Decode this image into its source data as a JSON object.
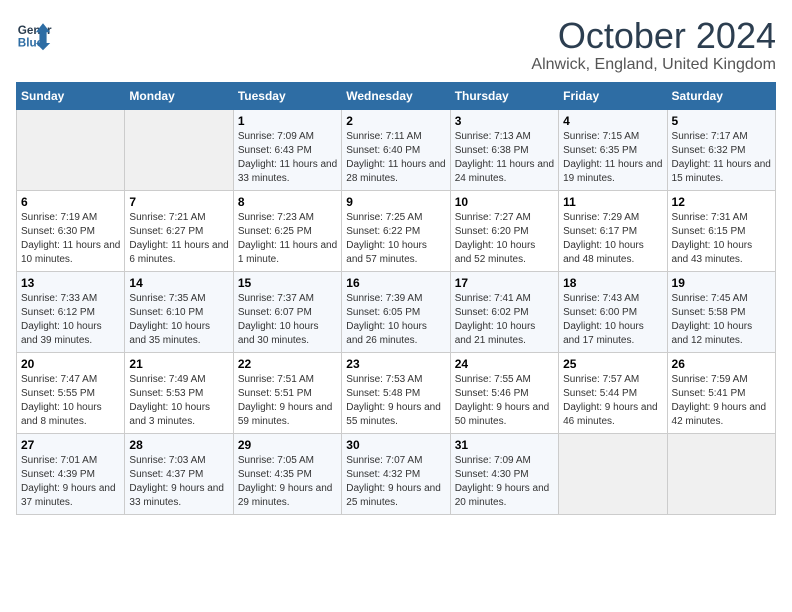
{
  "header": {
    "logo_line1": "General",
    "logo_line2": "Blue",
    "month": "October 2024",
    "location": "Alnwick, England, United Kingdom"
  },
  "days_of_week": [
    "Sunday",
    "Monday",
    "Tuesday",
    "Wednesday",
    "Thursday",
    "Friday",
    "Saturday"
  ],
  "weeks": [
    [
      {
        "day": "",
        "sunrise": "",
        "sunset": "",
        "daylight": ""
      },
      {
        "day": "",
        "sunrise": "",
        "sunset": "",
        "daylight": ""
      },
      {
        "day": "1",
        "sunrise": "Sunrise: 7:09 AM",
        "sunset": "Sunset: 6:43 PM",
        "daylight": "Daylight: 11 hours and 33 minutes."
      },
      {
        "day": "2",
        "sunrise": "Sunrise: 7:11 AM",
        "sunset": "Sunset: 6:40 PM",
        "daylight": "Daylight: 11 hours and 28 minutes."
      },
      {
        "day": "3",
        "sunrise": "Sunrise: 7:13 AM",
        "sunset": "Sunset: 6:38 PM",
        "daylight": "Daylight: 11 hours and 24 minutes."
      },
      {
        "day": "4",
        "sunrise": "Sunrise: 7:15 AM",
        "sunset": "Sunset: 6:35 PM",
        "daylight": "Daylight: 11 hours and 19 minutes."
      },
      {
        "day": "5",
        "sunrise": "Sunrise: 7:17 AM",
        "sunset": "Sunset: 6:32 PM",
        "daylight": "Daylight: 11 hours and 15 minutes."
      }
    ],
    [
      {
        "day": "6",
        "sunrise": "Sunrise: 7:19 AM",
        "sunset": "Sunset: 6:30 PM",
        "daylight": "Daylight: 11 hours and 10 minutes."
      },
      {
        "day": "7",
        "sunrise": "Sunrise: 7:21 AM",
        "sunset": "Sunset: 6:27 PM",
        "daylight": "Daylight: 11 hours and 6 minutes."
      },
      {
        "day": "8",
        "sunrise": "Sunrise: 7:23 AM",
        "sunset": "Sunset: 6:25 PM",
        "daylight": "Daylight: 11 hours and 1 minute."
      },
      {
        "day": "9",
        "sunrise": "Sunrise: 7:25 AM",
        "sunset": "Sunset: 6:22 PM",
        "daylight": "Daylight: 10 hours and 57 minutes."
      },
      {
        "day": "10",
        "sunrise": "Sunrise: 7:27 AM",
        "sunset": "Sunset: 6:20 PM",
        "daylight": "Daylight: 10 hours and 52 minutes."
      },
      {
        "day": "11",
        "sunrise": "Sunrise: 7:29 AM",
        "sunset": "Sunset: 6:17 PM",
        "daylight": "Daylight: 10 hours and 48 minutes."
      },
      {
        "day": "12",
        "sunrise": "Sunrise: 7:31 AM",
        "sunset": "Sunset: 6:15 PM",
        "daylight": "Daylight: 10 hours and 43 minutes."
      }
    ],
    [
      {
        "day": "13",
        "sunrise": "Sunrise: 7:33 AM",
        "sunset": "Sunset: 6:12 PM",
        "daylight": "Daylight: 10 hours and 39 minutes."
      },
      {
        "day": "14",
        "sunrise": "Sunrise: 7:35 AM",
        "sunset": "Sunset: 6:10 PM",
        "daylight": "Daylight: 10 hours and 35 minutes."
      },
      {
        "day": "15",
        "sunrise": "Sunrise: 7:37 AM",
        "sunset": "Sunset: 6:07 PM",
        "daylight": "Daylight: 10 hours and 30 minutes."
      },
      {
        "day": "16",
        "sunrise": "Sunrise: 7:39 AM",
        "sunset": "Sunset: 6:05 PM",
        "daylight": "Daylight: 10 hours and 26 minutes."
      },
      {
        "day": "17",
        "sunrise": "Sunrise: 7:41 AM",
        "sunset": "Sunset: 6:02 PM",
        "daylight": "Daylight: 10 hours and 21 minutes."
      },
      {
        "day": "18",
        "sunrise": "Sunrise: 7:43 AM",
        "sunset": "Sunset: 6:00 PM",
        "daylight": "Daylight: 10 hours and 17 minutes."
      },
      {
        "day": "19",
        "sunrise": "Sunrise: 7:45 AM",
        "sunset": "Sunset: 5:58 PM",
        "daylight": "Daylight: 10 hours and 12 minutes."
      }
    ],
    [
      {
        "day": "20",
        "sunrise": "Sunrise: 7:47 AM",
        "sunset": "Sunset: 5:55 PM",
        "daylight": "Daylight: 10 hours and 8 minutes."
      },
      {
        "day": "21",
        "sunrise": "Sunrise: 7:49 AM",
        "sunset": "Sunset: 5:53 PM",
        "daylight": "Daylight: 10 hours and 3 minutes."
      },
      {
        "day": "22",
        "sunrise": "Sunrise: 7:51 AM",
        "sunset": "Sunset: 5:51 PM",
        "daylight": "Daylight: 9 hours and 59 minutes."
      },
      {
        "day": "23",
        "sunrise": "Sunrise: 7:53 AM",
        "sunset": "Sunset: 5:48 PM",
        "daylight": "Daylight: 9 hours and 55 minutes."
      },
      {
        "day": "24",
        "sunrise": "Sunrise: 7:55 AM",
        "sunset": "Sunset: 5:46 PM",
        "daylight": "Daylight: 9 hours and 50 minutes."
      },
      {
        "day": "25",
        "sunrise": "Sunrise: 7:57 AM",
        "sunset": "Sunset: 5:44 PM",
        "daylight": "Daylight: 9 hours and 46 minutes."
      },
      {
        "day": "26",
        "sunrise": "Sunrise: 7:59 AM",
        "sunset": "Sunset: 5:41 PM",
        "daylight": "Daylight: 9 hours and 42 minutes."
      }
    ],
    [
      {
        "day": "27",
        "sunrise": "Sunrise: 7:01 AM",
        "sunset": "Sunset: 4:39 PM",
        "daylight": "Daylight: 9 hours and 37 minutes."
      },
      {
        "day": "28",
        "sunrise": "Sunrise: 7:03 AM",
        "sunset": "Sunset: 4:37 PM",
        "daylight": "Daylight: 9 hours and 33 minutes."
      },
      {
        "day": "29",
        "sunrise": "Sunrise: 7:05 AM",
        "sunset": "Sunset: 4:35 PM",
        "daylight": "Daylight: 9 hours and 29 minutes."
      },
      {
        "day": "30",
        "sunrise": "Sunrise: 7:07 AM",
        "sunset": "Sunset: 4:32 PM",
        "daylight": "Daylight: 9 hours and 25 minutes."
      },
      {
        "day": "31",
        "sunrise": "Sunrise: 7:09 AM",
        "sunset": "Sunset: 4:30 PM",
        "daylight": "Daylight: 9 hours and 20 minutes."
      },
      {
        "day": "",
        "sunrise": "",
        "sunset": "",
        "daylight": ""
      },
      {
        "day": "",
        "sunrise": "",
        "sunset": "",
        "daylight": ""
      }
    ]
  ]
}
